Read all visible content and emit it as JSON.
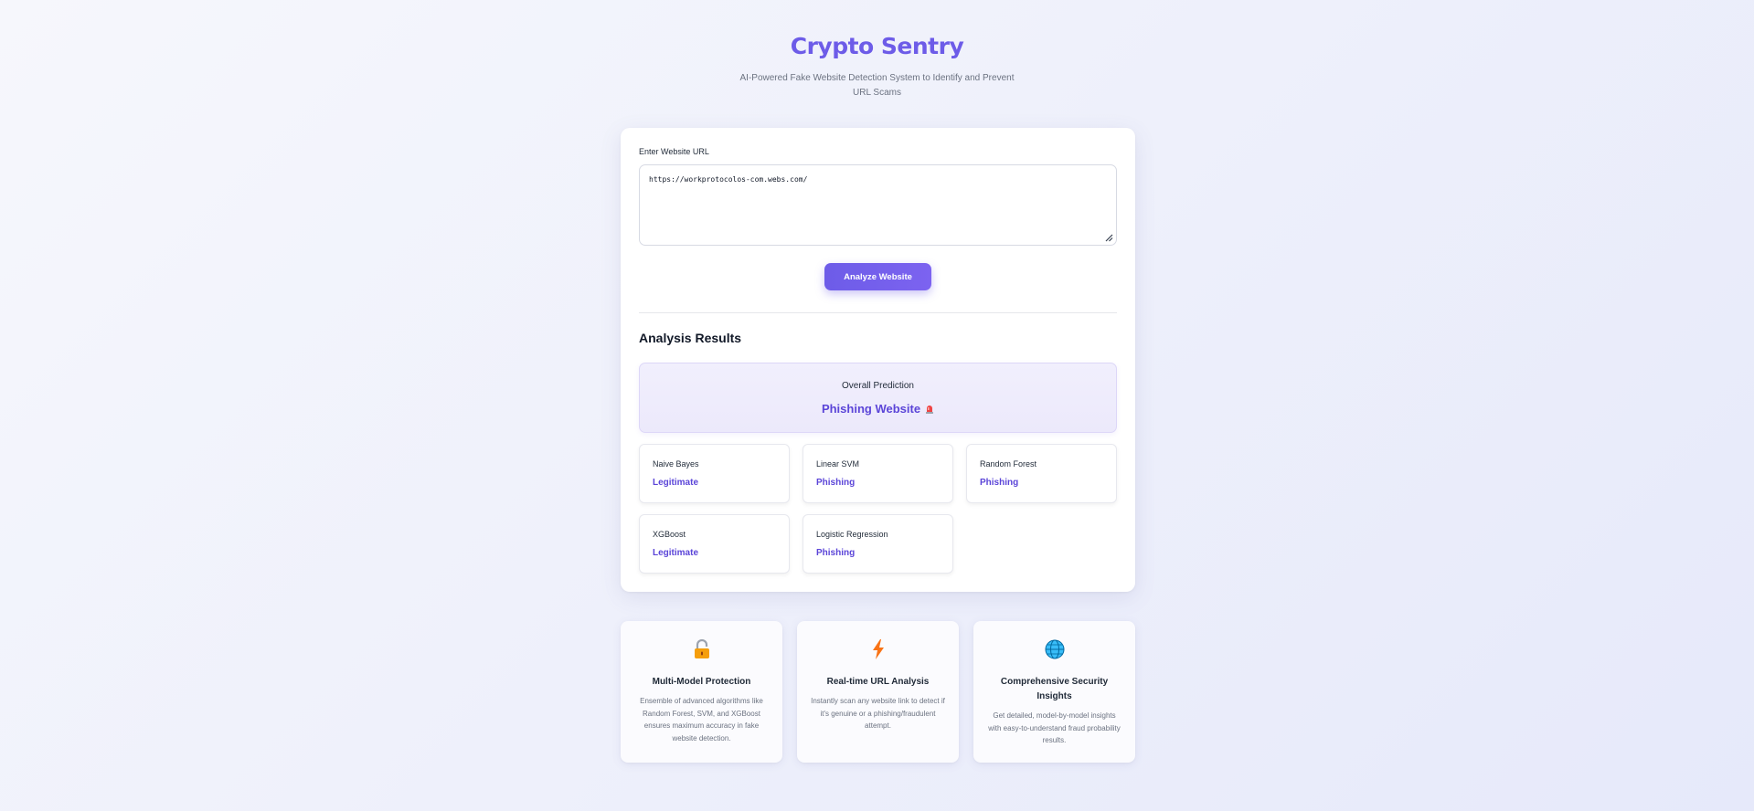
{
  "header": {
    "title": "Crypto Sentry",
    "subtitle": "AI-Powered Fake Website Detection System to Identify and Prevent URL Scams"
  },
  "form": {
    "url_label": "Enter Website URL",
    "url_value": "https://workprotocolos-com.webs.com/",
    "analyze_button": "Analyze Website"
  },
  "results": {
    "title": "Analysis Results",
    "overall_label": "Overall Prediction",
    "overall_value": "Phishing Website",
    "models": [
      {
        "name": "Naive Bayes",
        "result": "Legitimate"
      },
      {
        "name": "Linear SVM",
        "result": "Phishing"
      },
      {
        "name": "Random Forest",
        "result": "Phishing"
      },
      {
        "name": "XGBoost",
        "result": "Legitimate"
      },
      {
        "name": "Logistic Regression",
        "result": "Phishing"
      }
    ]
  },
  "features": [
    {
      "icon": "lock-icon",
      "title": "Multi-Model Protection",
      "description": "Ensemble of advanced algorithms like Random Forest, SVM, and XGBoost ensures maximum accuracy in fake website detection."
    },
    {
      "icon": "lightning-icon",
      "title": "Real-time URL Analysis",
      "description": "Instantly scan any website link to detect if it's genuine or a phishing/fraudulent attempt."
    },
    {
      "icon": "globe-icon",
      "title": "Comprehensive Security Insights",
      "description": "Get detailed, model-by-model insights with easy-to-understand fraud probability results."
    }
  ],
  "colors": {
    "accent": "#6d5ce8",
    "result_text": "#5b45d8"
  }
}
